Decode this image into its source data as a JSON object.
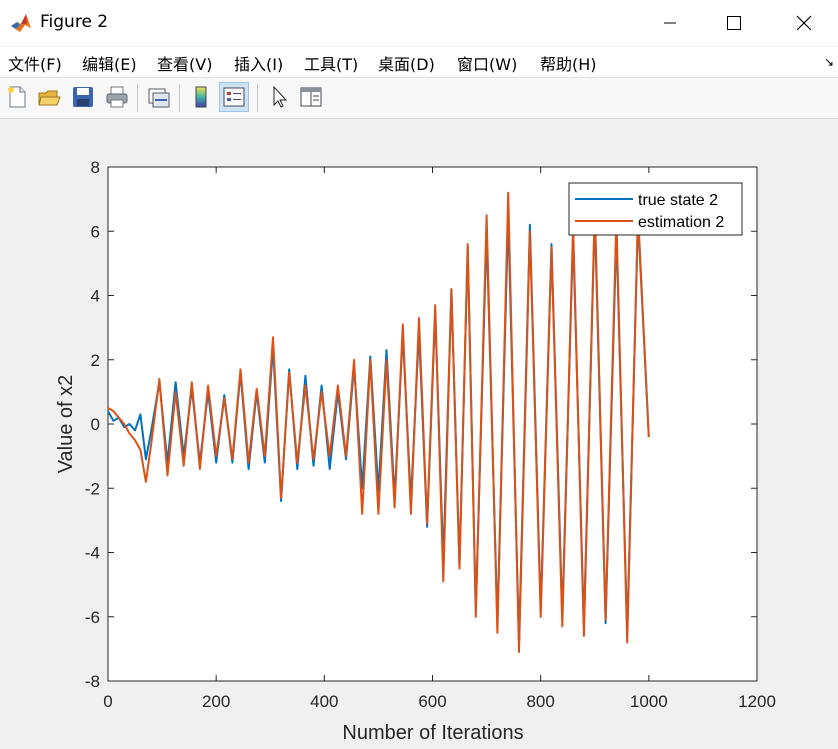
{
  "window": {
    "title": "Figure 2",
    "controls": {
      "minimize": "—",
      "maximize": "☐",
      "close": "✕"
    },
    "app_icon": "matlab-logo-icon"
  },
  "menu": {
    "items": [
      "文件(F)",
      "编辑(E)",
      "查看(V)",
      "插入(I)",
      "工具(T)",
      "桌面(D)",
      "窗口(W)",
      "帮助(H)"
    ],
    "dock_arrow": "↘"
  },
  "toolbar": {
    "buttons": [
      {
        "name": "new-figure-icon",
        "active": false
      },
      {
        "name": "open-file-icon",
        "active": false
      },
      {
        "name": "save-icon",
        "active": false
      },
      {
        "name": "print-icon",
        "active": false
      },
      {
        "name": "link-plot-icon",
        "active": false
      },
      {
        "name": "colorbar-icon",
        "active": false
      },
      {
        "name": "legend-icon",
        "active": true
      },
      {
        "name": "cursor-icon",
        "active": false
      },
      {
        "name": "property-editor-icon",
        "active": false
      }
    ]
  },
  "chart_data": {
    "type": "line",
    "title": "",
    "xlabel": "Number of Iterations",
    "ylabel": "Value of x2",
    "xlim": [
      0,
      1200
    ],
    "ylim": [
      -8,
      8
    ],
    "xticks": [
      "0",
      "200",
      "400",
      "600",
      "800",
      "1000",
      "1200"
    ],
    "yticks": [
      "-8",
      "-6",
      "-4",
      "-2",
      "0",
      "2",
      "4",
      "6",
      "8"
    ],
    "grid": false,
    "legend_position": "top-right",
    "colors": {
      "true_state": "#0072bd",
      "estimation": "#d95319"
    },
    "series": [
      {
        "name": "true state 2",
        "color": "#0072bd",
        "x": [
          0,
          10,
          20,
          30,
          40,
          50,
          60,
          70,
          80,
          95,
          110,
          125,
          140,
          155,
          170,
          185,
          200,
          215,
          230,
          245,
          260,
          275,
          290,
          305,
          320,
          335,
          350,
          365,
          380,
          395,
          410,
          425,
          440,
          455,
          470,
          485,
          500,
          515,
          530,
          545,
          560,
          575,
          590,
          605,
          620,
          635,
          650,
          665,
          680,
          700,
          720,
          740,
          760,
          780,
          800,
          820,
          840,
          860,
          880,
          900,
          920,
          940,
          960,
          980,
          1000
        ],
        "y": [
          0.4,
          0.1,
          0.2,
          -0.1,
          0.0,
          -0.2,
          0.3,
          -1.1,
          -0.2,
          1.3,
          -1.2,
          1.3,
          -1.0,
          1.1,
          -1.2,
          1.0,
          -1.2,
          0.9,
          -1.2,
          1.6,
          -1.4,
          1.0,
          -1.2,
          2.4,
          -2.4,
          1.7,
          -1.4,
          1.5,
          -1.3,
          1.2,
          -1.4,
          1.0,
          -1.1,
          1.8,
          -2.0,
          2.1,
          -2.1,
          2.3,
          -2.3,
          2.8,
          -2.4,
          2.9,
          -3.2,
          3.5,
          -4.3,
          4.2,
          -4.4,
          5.5,
          -5.8,
          6.0,
          -6.2,
          6.5,
          -6.8,
          6.2,
          -5.8,
          5.6,
          -6.0,
          5.9,
          -6.3,
          6.5,
          -6.2,
          6.0,
          -6.5,
          6.4,
          -0.4
        ]
      },
      {
        "name": "estimation 2",
        "color": "#d95319",
        "x": [
          0,
          10,
          20,
          30,
          40,
          50,
          60,
          70,
          80,
          95,
          110,
          125,
          140,
          155,
          170,
          185,
          200,
          215,
          230,
          245,
          260,
          275,
          290,
          305,
          320,
          335,
          350,
          365,
          380,
          395,
          410,
          425,
          440,
          455,
          470,
          485,
          500,
          515,
          530,
          545,
          560,
          575,
          590,
          605,
          620,
          635,
          650,
          665,
          680,
          700,
          720,
          740,
          760,
          780,
          800,
          820,
          840,
          860,
          880,
          900,
          920,
          940,
          960,
          980,
          1000
        ],
        "y": [
          0.5,
          0.4,
          0.2,
          0.0,
          -0.3,
          -0.5,
          -0.8,
          -1.8,
          -0.6,
          1.4,
          -1.6,
          1.0,
          -1.3,
          1.3,
          -1.4,
          1.2,
          -1.0,
          0.8,
          -1.1,
          1.7,
          -1.2,
          1.1,
          -1.0,
          2.7,
          -2.3,
          1.6,
          -1.2,
          1.2,
          -1.1,
          1.0,
          -1.0,
          1.2,
          -1.0,
          2.0,
          -2.8,
          2.0,
          -2.8,
          2.0,
          -2.6,
          3.1,
          -2.8,
          3.3,
          -3.1,
          3.7,
          -4.9,
          4.2,
          -4.5,
          5.6,
          -6.0,
          6.5,
          -6.5,
          7.2,
          -7.1,
          6.0,
          -6.0,
          5.5,
          -6.3,
          6.2,
          -6.6,
          6.8,
          -6.1,
          6.4,
          -6.8,
          6.6,
          -0.4
        ]
      }
    ]
  }
}
